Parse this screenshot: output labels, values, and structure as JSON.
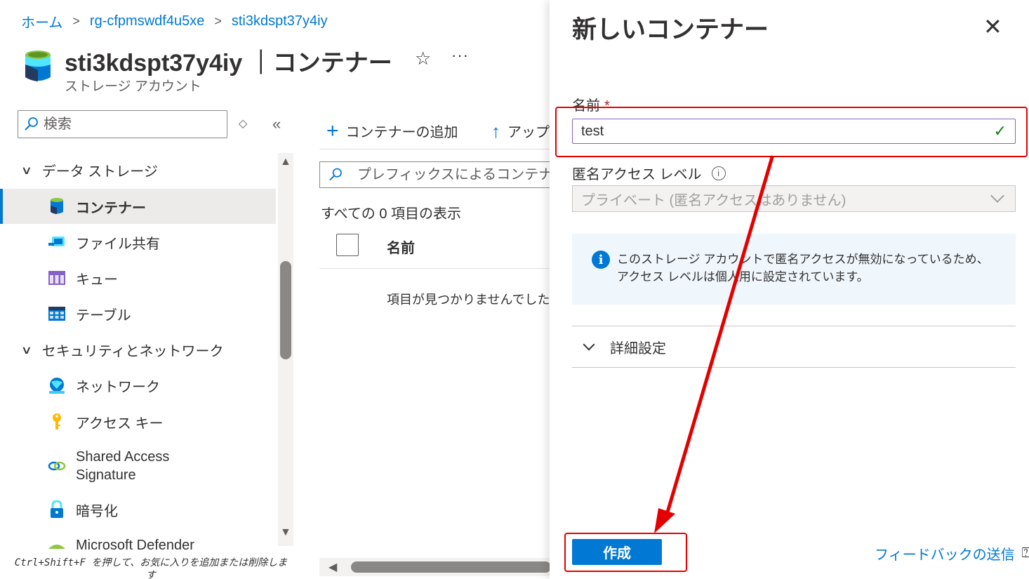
{
  "breadcrumb": {
    "home": "ホーム",
    "resource_group": "rg-cfpmswdf4u5xe",
    "storage": "sti3kdspt37y4iy",
    "separator": ">"
  },
  "header": {
    "title": "sti3kdspt37y4iy ｜コンテナー",
    "subtitle": "ストレージ アカウント",
    "star_glyph": "☆",
    "more_glyph": "···"
  },
  "sidebar": {
    "search_placeholder": "検索",
    "groups": [
      {
        "label": "データ ストレージ"
      },
      {
        "label": "セキュリティとネットワーク"
      }
    ],
    "items": [
      {
        "label": "コンテナー",
        "icon": "container-icon"
      },
      {
        "label": "ファイル共有",
        "icon": "file-share-icon"
      },
      {
        "label": "キュー",
        "icon": "queue-icon"
      },
      {
        "label": "テーブル",
        "icon": "table-icon"
      },
      {
        "label": "ネットワーク",
        "icon": "network-icon"
      },
      {
        "label": "アクセス キー",
        "icon": "key-icon"
      },
      {
        "label_line1": "Shared Access",
        "label_line2": "Signature",
        "icon": "link-icon"
      },
      {
        "label": "暗号化",
        "icon": "lock-icon"
      },
      {
        "label": "Microsoft Defender",
        "icon": "defender-icon"
      }
    ],
    "footer_hint": "Ctrl+Shift+F を押して、お気に入りを追加または削除します"
  },
  "main": {
    "add_container": "コンテナーの追加",
    "upload": "アップ",
    "filter_placeholder": "プレフィックスによるコンテナーの検索",
    "count_text": "すべての 0 項目の表示",
    "column_name": "名前",
    "empty_text": "項目が見つかりませんでした"
  },
  "panel": {
    "title": "新しいコンテナー",
    "name_label": "名前",
    "required_mark": "*",
    "name_value": "test",
    "access_label": "匿名アクセス レベル",
    "access_value": "プライベート (匿名アクセスはありません)",
    "info_text": "このストレージ アカウントで匿名アクセスが無効になっているため、アクセス レベルは個人用に設定されています。",
    "advanced_label": "詳細設定",
    "create_button": "作成",
    "feedback_link": "フィードバックの送信"
  },
  "colors": {
    "accent": "#0078d4",
    "annotation": "#e50000",
    "valid_check": "#107c10"
  }
}
